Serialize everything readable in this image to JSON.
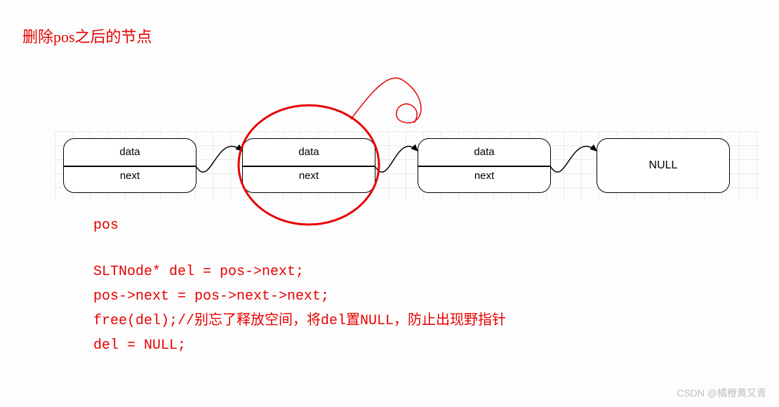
{
  "title": "删除pos之后的节点",
  "nodes": {
    "n1": {
      "data": "data",
      "next": "next"
    },
    "n2": {
      "data": "data",
      "next": "next"
    },
    "n3": {
      "data": "data",
      "next": "next"
    },
    "null": "NULL"
  },
  "pos_label": "pos",
  "code": {
    "line1": "SLTNode* del = pos->next;",
    "line2": "pos->next = pos->next->next;",
    "line3": "free(del);//别忘了释放空间，将del置NULL，防止出现野指针",
    "line4": "del = NULL;"
  },
  "watermark": "CSDN @橘橙黄又青"
}
